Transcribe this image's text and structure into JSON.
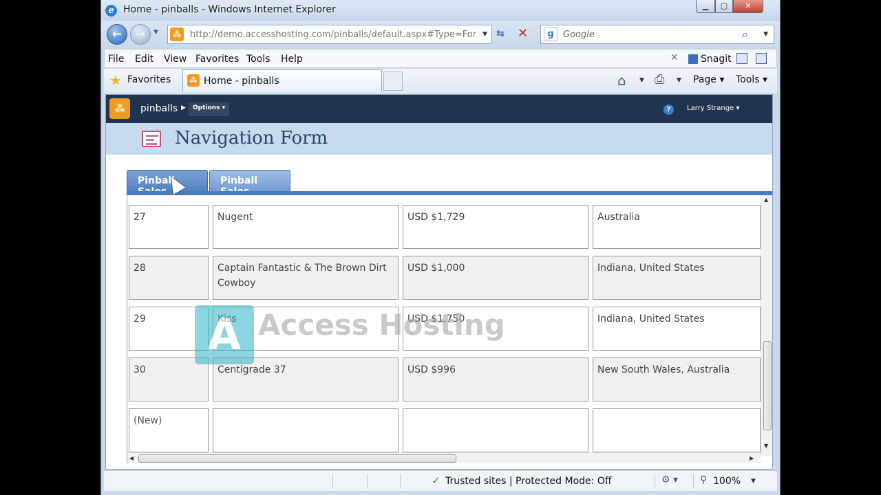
{
  "window": {
    "title": "Home - pinballs - Windows Internet Explorer"
  },
  "address": {
    "url": "http://demo.accesshosting.com/pinballs/default.aspx#Type=For"
  },
  "search": {
    "placeholder": "Google"
  },
  "menu": [
    "File",
    "Edit",
    "View",
    "Favorites",
    "Tools",
    "Help"
  ],
  "snagit": {
    "label": "Snagit"
  },
  "favorites_bar": {
    "label": "Favorites",
    "tab_title": "Home - pinballs"
  },
  "commandbar": {
    "page_label": "Page",
    "tools_label": "Tools"
  },
  "sharepoint": {
    "site": "pinballs",
    "options": "Options",
    "user": "Larry Strange"
  },
  "form": {
    "title": "Navigation Form",
    "tabs": [
      "Pinball Sales",
      "Pinball Sales"
    ],
    "rows": [
      {
        "id": "27",
        "name": "Nugent",
        "price": "USD $1,729",
        "location": "Australia"
      },
      {
        "id": "28",
        "name": "Captain Fantastic & The Brown Dirt Cowboy",
        "price": "USD $1,000",
        "location": "Indiana, United States"
      },
      {
        "id": "29",
        "name": "Kiss",
        "price": "USD $1,750",
        "location": "Indiana, United States"
      },
      {
        "id": "30",
        "name": "Centigrade 37",
        "price": "USD $996",
        "location": "New South Wales, Australia"
      },
      {
        "id": "(New)",
        "name": "",
        "price": "",
        "location": ""
      }
    ]
  },
  "watermark": {
    "text": "Access Hosting"
  },
  "statusbar": {
    "security": "Trusted sites | Protected Mode: Off",
    "zoom": "100%"
  },
  "icons": [
    "ie-icon",
    "back-arrow-icon",
    "forward-arrow-icon",
    "refresh-icon",
    "stop-icon",
    "google-icon",
    "search-icon",
    "favorites-star-icon",
    "home-icon",
    "print-icon",
    "help-icon",
    "form-icon",
    "checkmark-icon",
    "zoom-icon"
  ]
}
